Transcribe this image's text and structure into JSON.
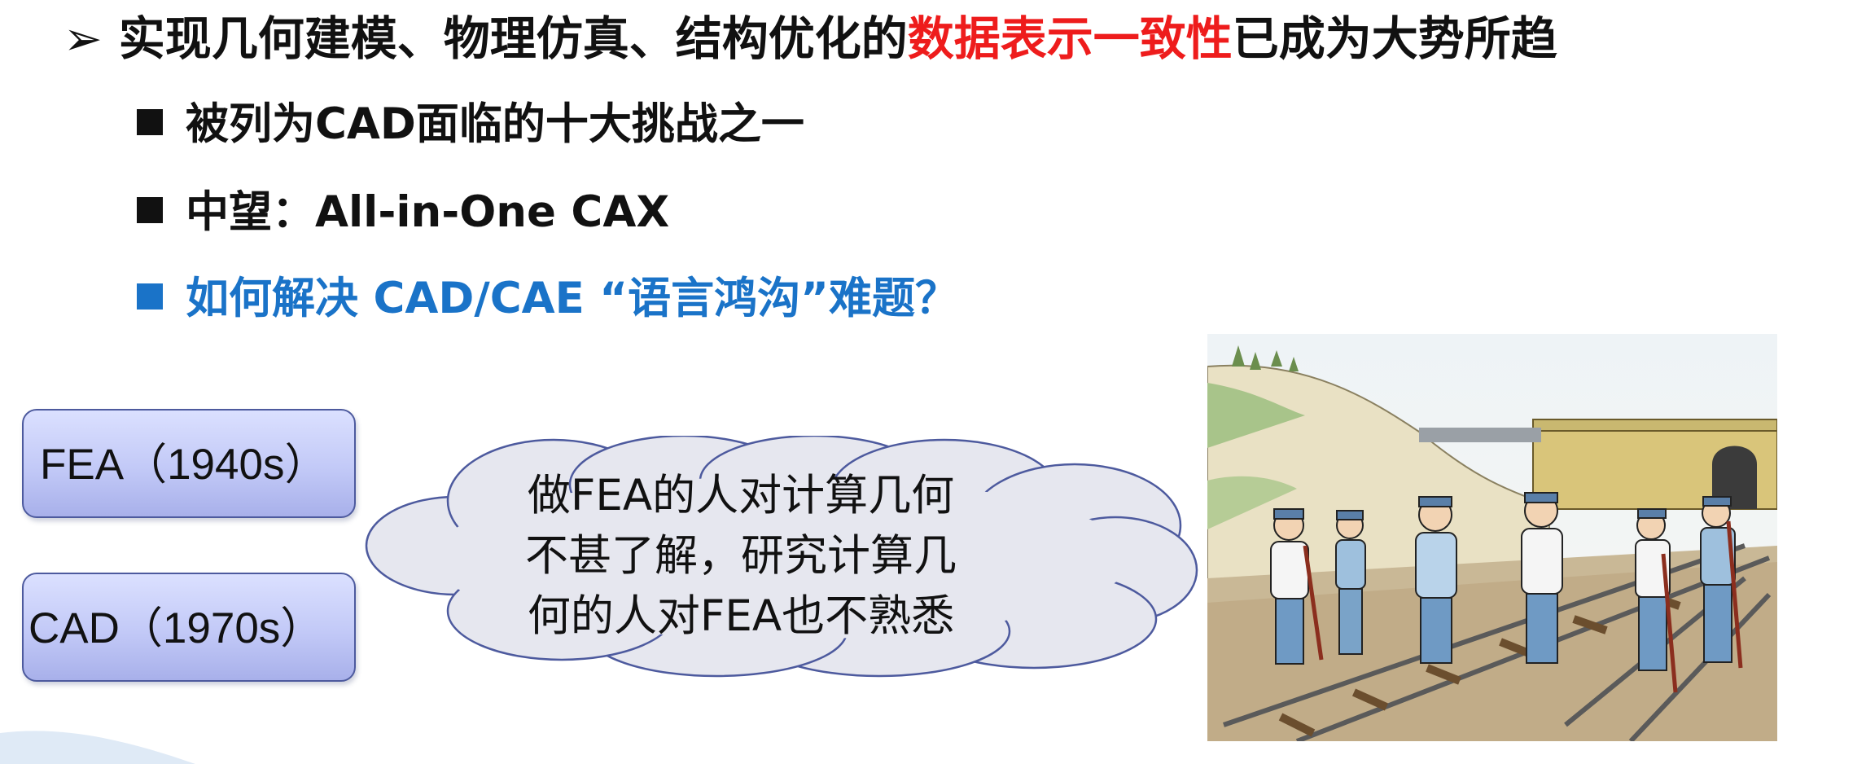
{
  "bullets": {
    "main": {
      "marker": "➢",
      "prefix": "实现几何建模、物理仿真、结构优化的",
      "highlight": "数据表示一致性",
      "suffix": "已成为大势所趋"
    },
    "items": [
      {
        "text": "被列为CAD面临的十大挑战之一"
      },
      {
        "text": "中望：All-in-One CAX"
      },
      {
        "text": "如何解决 CAD/CAE “语言鸿沟”难题？"
      }
    ]
  },
  "boxes": {
    "fea": "FEA（1940s）",
    "cad": "CAD（1970s）"
  },
  "cloud": {
    "lines": [
      "做FEA的人对计算几何",
      "不甚了解，研究计算几",
      "何的人对FEA也不熟悉"
    ]
  },
  "colors": {
    "highlight": "#ee1c1c",
    "question": "#1a73c8",
    "box_border": "#4d5a9e",
    "cloud_fill": "#e6e7ef",
    "cloud_border": "#4d5a9e"
  },
  "icons": {
    "main_marker": "arrowhead-bullet-icon",
    "item_marker": "square-bullet-icon"
  }
}
